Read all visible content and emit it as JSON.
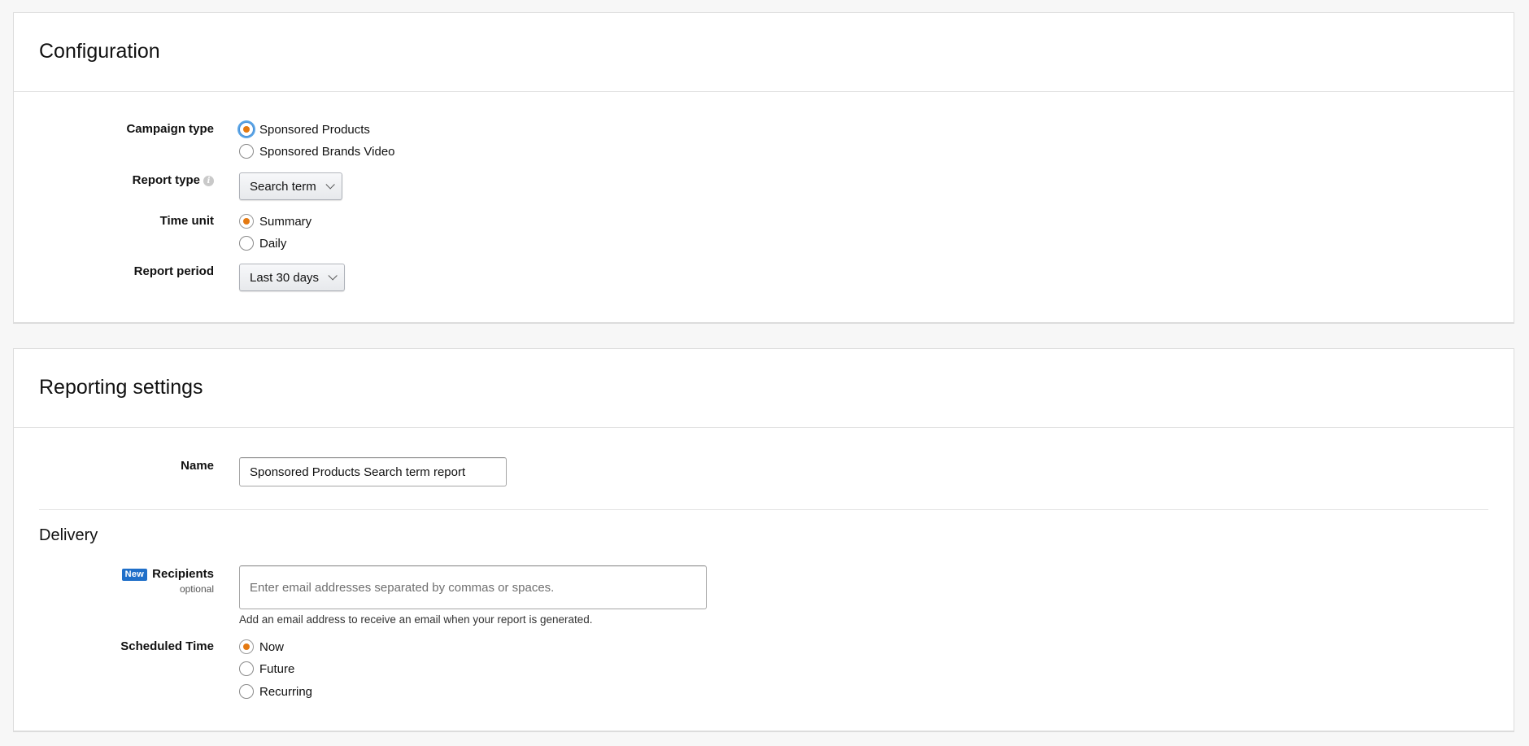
{
  "colors": {
    "accent_radio": "#e47911",
    "focus_ring": "#5aa5e6",
    "badge_blue": "#1f6fc9"
  },
  "configuration": {
    "title": "Configuration",
    "campaign_type": {
      "label": "Campaign type",
      "options": [
        {
          "label": "Sponsored Products",
          "checked": true
        },
        {
          "label": "Sponsored Brands Video",
          "checked": false
        }
      ]
    },
    "report_type": {
      "label": "Report type",
      "info_icon": "info-icon",
      "selected": "Search term"
    },
    "time_unit": {
      "label": "Time unit",
      "options": [
        {
          "label": "Summary",
          "checked": true
        },
        {
          "label": "Daily",
          "checked": false
        }
      ]
    },
    "report_period": {
      "label": "Report period",
      "selected": "Last 30 days"
    }
  },
  "reporting_settings": {
    "title": "Reporting settings",
    "name": {
      "label": "Name",
      "value": "Sponsored Products Search term report"
    },
    "delivery": {
      "heading": "Delivery",
      "recipients": {
        "badge": "New",
        "label": "Recipients",
        "optional": "optional",
        "placeholder": "Enter email addresses separated by commas or spaces.",
        "value": "",
        "help": "Add an email address to receive an email when your report is generated."
      },
      "scheduled_time": {
        "label": "Scheduled Time",
        "options": [
          {
            "label": "Now",
            "checked": true
          },
          {
            "label": "Future",
            "checked": false
          },
          {
            "label": "Recurring",
            "checked": false
          }
        ]
      }
    }
  }
}
